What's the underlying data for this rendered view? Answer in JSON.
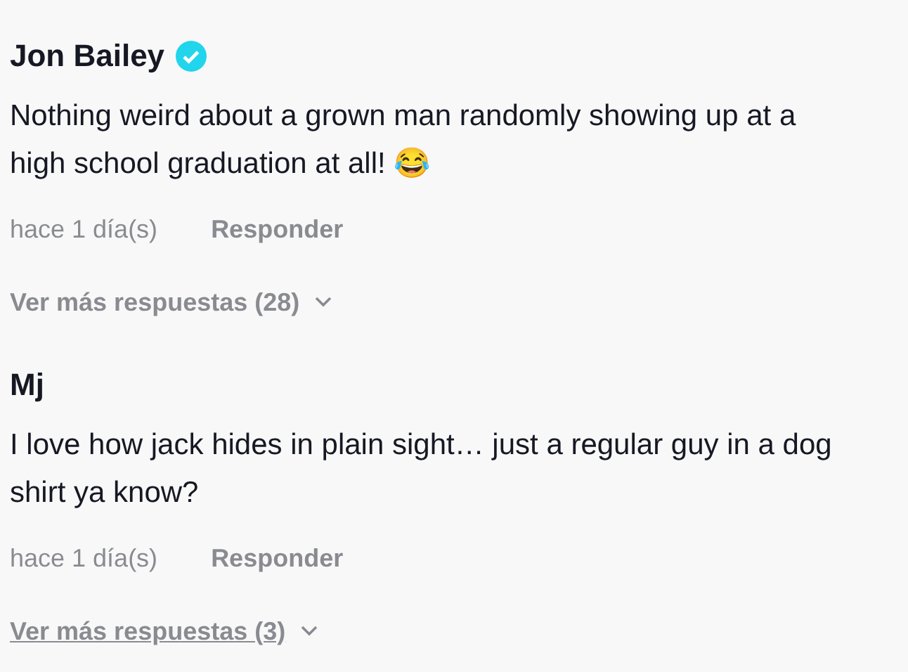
{
  "comments": [
    {
      "author": "Jon Bailey",
      "verified": true,
      "text": "Nothing weird about a grown man randomly showing up at a high school graduation at all! 😂",
      "time": "hace 1 día(s)",
      "reply": "Responder",
      "more_replies": {
        "label": "Ver más respuestas (28)",
        "hovered": false
      }
    },
    {
      "author": "Mj",
      "verified": false,
      "text": "I love how jack hides in plain sight… just a regular guy in a dog shirt ya know?",
      "time": "hace 1 día(s)",
      "reply": "Responder",
      "more_replies": {
        "label": "Ver más respuestas (3)",
        "hovered": true
      }
    }
  ]
}
